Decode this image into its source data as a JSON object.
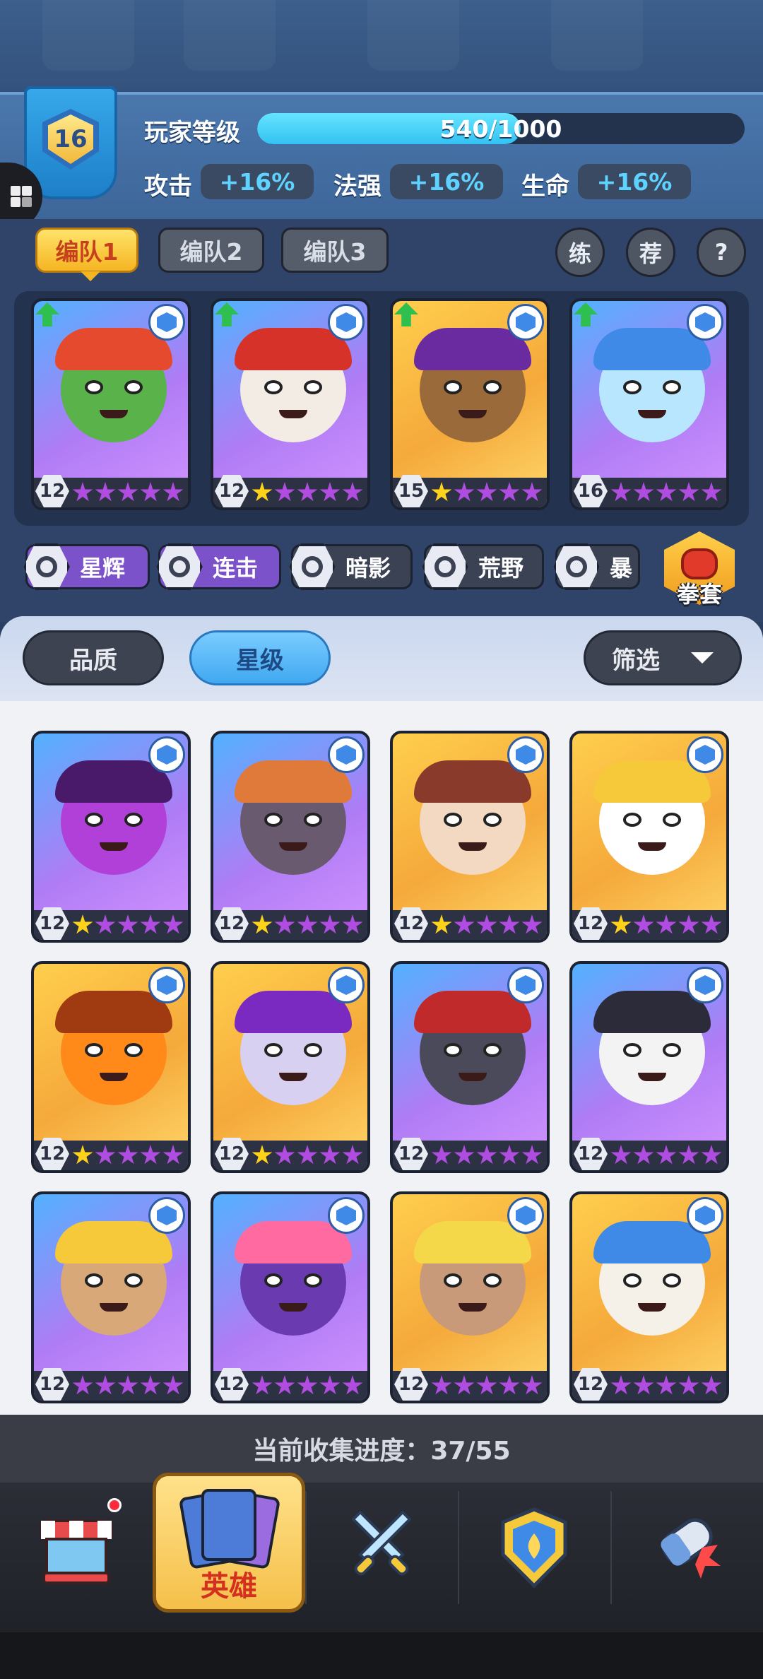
{
  "player": {
    "level": "16",
    "level_label": "玩家等级",
    "xp_text": "540/1000",
    "xp_fraction": 0.54,
    "stats": [
      {
        "label": "攻击",
        "value": "+16%"
      },
      {
        "label": "法强",
        "value": "+16%"
      },
      {
        "label": "生命",
        "value": "+16%"
      }
    ]
  },
  "team_tabs": [
    {
      "label": "编队1",
      "active": true
    },
    {
      "label": "编队2",
      "active": false
    },
    {
      "label": "编队3",
      "active": false
    }
  ],
  "quick_buttons": [
    {
      "label": "练"
    },
    {
      "label": "荐"
    },
    {
      "label": "?"
    }
  ],
  "team_cards": [
    {
      "level": "12",
      "stars_lit": 0,
      "bg": "purple",
      "upgrade": true
    },
    {
      "level": "12",
      "stars_lit": 1,
      "bg": "purple",
      "upgrade": true
    },
    {
      "level": "15",
      "stars_lit": 1,
      "bg": "gold",
      "upgrade": true
    },
    {
      "level": "16",
      "stars_lit": 0,
      "bg": "purple",
      "upgrade": true
    }
  ],
  "factions": [
    {
      "label": "星辉",
      "on": true
    },
    {
      "label": "连击",
      "on": true
    },
    {
      "label": "暗影",
      "on": false
    },
    {
      "label": "荒野",
      "on": false
    },
    {
      "label": "暴",
      "on": false
    }
  ],
  "gloves_label": "拳套",
  "sort": {
    "quality": "品质",
    "star": "星级",
    "filter": "筛选"
  },
  "collection_cards": [
    {
      "level": "12",
      "stars_lit": 1,
      "bg": "purple"
    },
    {
      "level": "12",
      "stars_lit": 1,
      "bg": "purple"
    },
    {
      "level": "12",
      "stars_lit": 1,
      "bg": "gold"
    },
    {
      "level": "12",
      "stars_lit": 1,
      "bg": "gold"
    },
    {
      "level": "12",
      "stars_lit": 1,
      "bg": "gold"
    },
    {
      "level": "12",
      "stars_lit": 1,
      "bg": "gold"
    },
    {
      "level": "12",
      "stars_lit": 0,
      "bg": "purple"
    },
    {
      "level": "12",
      "stars_lit": 0,
      "bg": "purple"
    },
    {
      "level": "12",
      "stars_lit": 0,
      "bg": "purple"
    },
    {
      "level": "12",
      "stars_lit": 0,
      "bg": "purple"
    },
    {
      "level": "12",
      "stars_lit": 0,
      "bg": "gold"
    },
    {
      "level": "12",
      "stars_lit": 0,
      "bg": "gold"
    }
  ],
  "collection_progress": "当前收集进度：37/55",
  "nav": {
    "active_label": "英雄",
    "items": [
      "shop-icon",
      "hero-cards-icon",
      "battle-swords-icon",
      "guild-shield-icon",
      "gacha-capsule-icon"
    ]
  }
}
